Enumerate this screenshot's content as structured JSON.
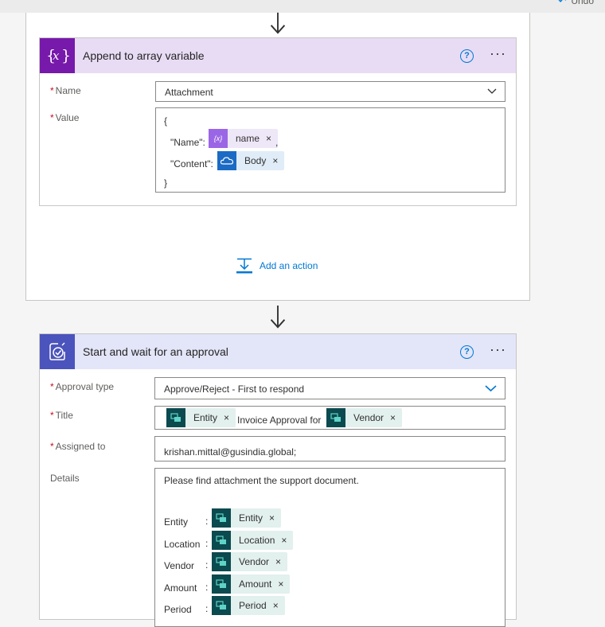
{
  "topbar": {
    "undo_label": "Undo"
  },
  "append_action": {
    "title": "Append to array variable",
    "icon": "variable-icon",
    "accent": "#7719aa",
    "header_bg": "#e8dcf5",
    "name_label": "Name",
    "name_value": "Attachment",
    "value_label": "Value",
    "value_lines": {
      "open_brace": "{",
      "name_key": "\"Name\":",
      "name_token": "name",
      "comma": ",",
      "content_key": "\"Content\":",
      "content_token": "Body",
      "close_brace": "}"
    }
  },
  "add_action_label": "Add an action",
  "approval_action": {
    "title": "Start and wait for an approval",
    "icon": "approval-icon",
    "accent": "#4b53bc",
    "header_bg": "#e3e5f8",
    "approval_type_label": "Approval type",
    "approval_type_value": "Approve/Reject - First to respond",
    "title_label": "Title",
    "title_tokens": [
      "Entity",
      "Vendor"
    ],
    "title_text": "Invoice Approval for",
    "assigned_label": "Assigned to",
    "assigned_value": "krishan.mittal@gusindia.global;",
    "details_label": "Details",
    "details_intro": "Please find attachment the support document.",
    "details_rows": [
      {
        "key": "Entity",
        "token": "Entity"
      },
      {
        "key": "Location",
        "token": "Location"
      },
      {
        "key": "Vendor",
        "token": "Vendor"
      },
      {
        "key": "Amount",
        "token": "Amount"
      },
      {
        "key": "Period",
        "token": "Period"
      }
    ],
    "details_colon": ":"
  },
  "remove_glyph": "×",
  "required_mark": "*"
}
